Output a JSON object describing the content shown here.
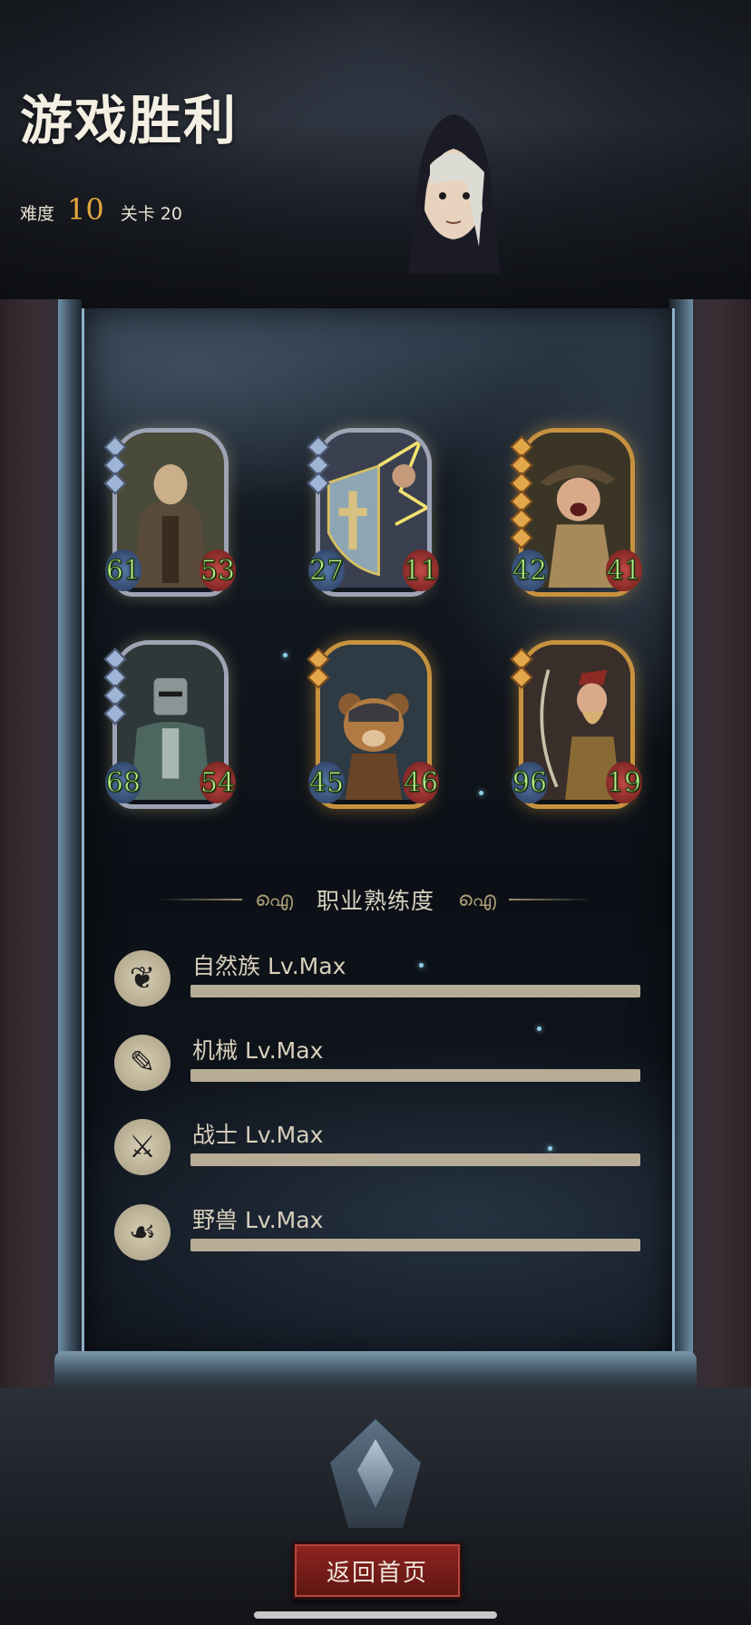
{
  "header": {
    "title": "游戏胜利",
    "difficulty_label": "难度",
    "difficulty_value": "10",
    "level_label": "关卡",
    "level_value": "20"
  },
  "cards": [
    {
      "attack": "61",
      "health": "53",
      "rarity": "silver",
      "gems": 3
    },
    {
      "attack": "27",
      "health": "11",
      "rarity": "silver",
      "gems": 3
    },
    {
      "attack": "42",
      "health": "41",
      "rarity": "gold",
      "gems": 6
    },
    {
      "attack": "68",
      "health": "54",
      "rarity": "silver",
      "gems": 4
    },
    {
      "attack": "45",
      "health": "46",
      "rarity": "gold",
      "gems": 2
    },
    {
      "attack": "96",
      "health": "19",
      "rarity": "gold",
      "gems": 2
    }
  ],
  "proficiency": {
    "heading": "职业熟练度",
    "items": [
      {
        "label": "自然族 Lv.Max",
        "icon": "nature-icon",
        "progress": 1.0
      },
      {
        "label": "机械 Lv.Max",
        "icon": "mechanical-icon",
        "progress": 1.0
      },
      {
        "label": "战士 Lv.Max",
        "icon": "warrior-icon",
        "progress": 1.0
      },
      {
        "label": "野兽 Lv.Max",
        "icon": "beast-icon",
        "progress": 1.0
      }
    ]
  },
  "buttons": {
    "return_home": "返回首页"
  },
  "colors": {
    "accent_gold": "#e3a63e",
    "button_red": "#8e2520",
    "stat_green": "#b8f08a"
  }
}
